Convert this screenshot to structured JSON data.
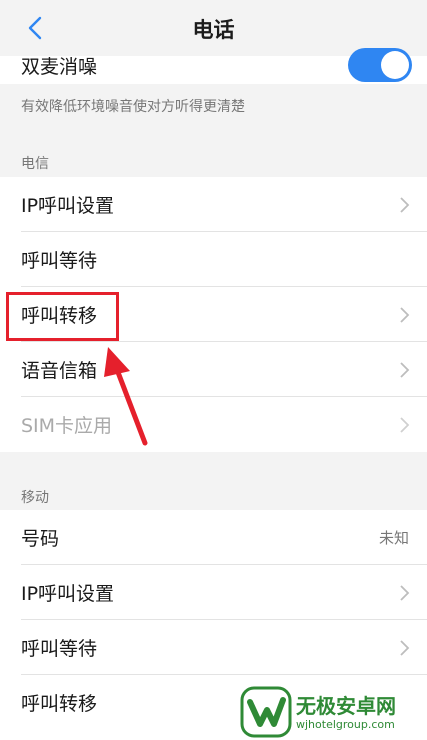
{
  "header": {
    "title": "电话",
    "back_icon": "chevron-left-icon"
  },
  "top": {
    "dual_mic_label": "双麦消噪",
    "dual_mic_enabled": true,
    "description": "有效降低环境噪音使对方听得更清楚"
  },
  "sections": [
    {
      "title": "电信",
      "items": [
        {
          "label": "IP呼叫设置",
          "chevron": true
        },
        {
          "label": "呼叫等待",
          "chevron": false
        },
        {
          "label": "呼叫转移",
          "chevron": true,
          "highlighted": true
        },
        {
          "label": "语音信箱",
          "chevron": true
        },
        {
          "label": "SIM卡应用",
          "chevron": true,
          "disabled": true
        }
      ]
    },
    {
      "title": "移动",
      "items": [
        {
          "label": "号码",
          "value": "未知"
        },
        {
          "label": "IP呼叫设置",
          "chevron": true
        },
        {
          "label": "呼叫等待",
          "chevron": true
        },
        {
          "label": "呼叫转移",
          "chevron": false
        }
      ]
    }
  ],
  "watermark": {
    "title": "无极安卓网",
    "url": "wjhotelgroup.com"
  },
  "colors": {
    "accent": "#2f86f2",
    "highlight": "#e5202c",
    "watermark": "#2f8a36"
  }
}
